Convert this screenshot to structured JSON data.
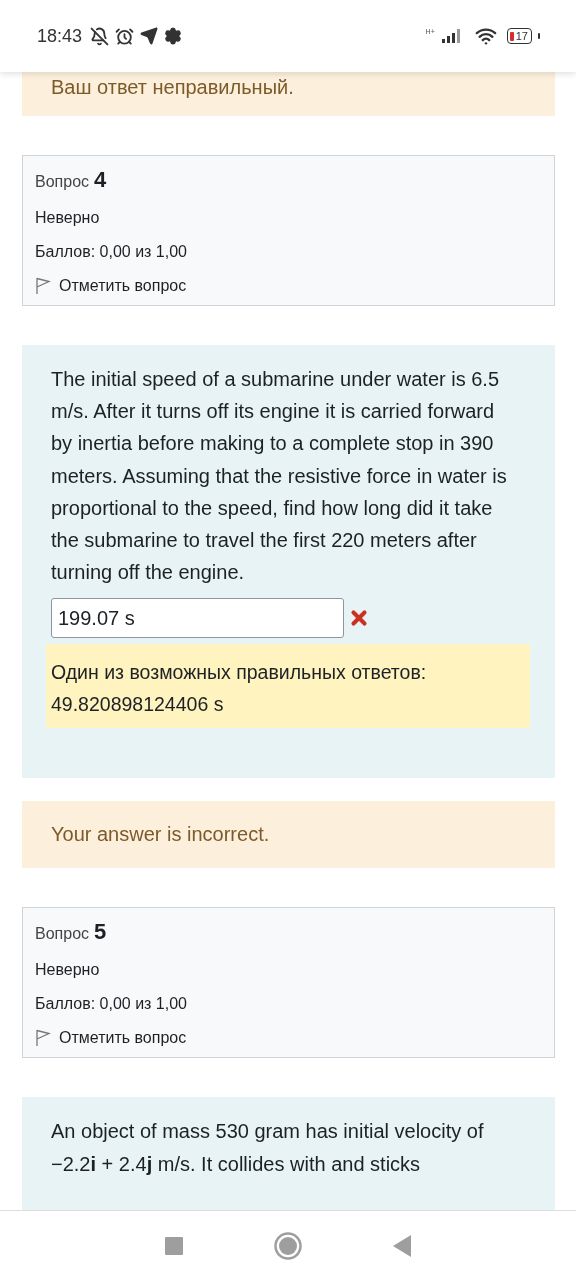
{
  "status_bar": {
    "time": "18:43",
    "network_label": "H+",
    "battery": "17"
  },
  "blocks": [
    {
      "kind": "feedback",
      "text": "Ваш ответ неправильный."
    },
    {
      "kind": "info",
      "label": "Вопрос",
      "number": "4",
      "state": "Неверно",
      "grade": "Баллов: 0,00 из 1,00",
      "flag": "Отметить вопрос"
    },
    {
      "kind": "question",
      "text": "The initial speed of a submarine under water is 6.5 m/s. After it turns off its engine it is carried forward by inertia before making to a complete stop in 390 meters. Assuming that the resistive force in water is proportional to the speed, find how long did it take the submarine to travel the first 220 meters after turning off the engine.",
      "answer": "199.07 s",
      "correct": false,
      "right_answer": "Один из возможных правильных ответов: 49.820898124406 s"
    },
    {
      "kind": "feedback",
      "text": "Your answer is incorrect."
    },
    {
      "kind": "info",
      "label": "Вопрос",
      "number": "5",
      "state": "Неверно",
      "grade": "Баллов: 0,00 из 1,00",
      "flag": "Отметить вопрос"
    },
    {
      "kind": "question",
      "text": "An object of mass 530 gram has initial velocity of −2.2**i** + 2.4**j** m/s. It collides with and sticks"
    }
  ]
}
